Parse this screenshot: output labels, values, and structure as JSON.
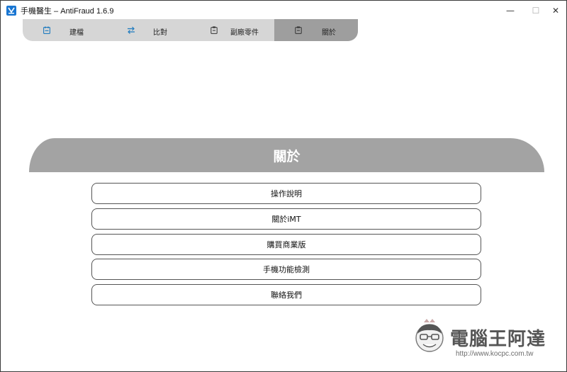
{
  "window": {
    "title": "手機醫生 – AntiFraud 1.6.9",
    "controls": {
      "minimize": "—",
      "maximize": "☐",
      "close": "✕"
    }
  },
  "nav": {
    "items": [
      {
        "label": "建檔",
        "icon": "calendar-icon"
      },
      {
        "label": "比對",
        "icon": "swap-arrows-icon"
      },
      {
        "label": "副廠零件",
        "icon": "clipboard-icon"
      },
      {
        "label": "關於",
        "icon": "clipboard-icon",
        "active": true
      }
    ]
  },
  "banner": {
    "title": "關於"
  },
  "menu": {
    "items": [
      {
        "label": "操作說明"
      },
      {
        "label": "關於iMT"
      },
      {
        "label": "購買商業版"
      },
      {
        "label": "手機功能檢測"
      },
      {
        "label": "聯絡我們"
      }
    ]
  },
  "watermark": {
    "brand": "電腦王阿達",
    "url": "http://www.kocpc.com.tw"
  },
  "colors": {
    "accent_icon": "#1f7bbf",
    "nav_bg": "#d6d6d6",
    "nav_active": "#9e9e9e",
    "banner_bg": "#a3a3a3"
  }
}
